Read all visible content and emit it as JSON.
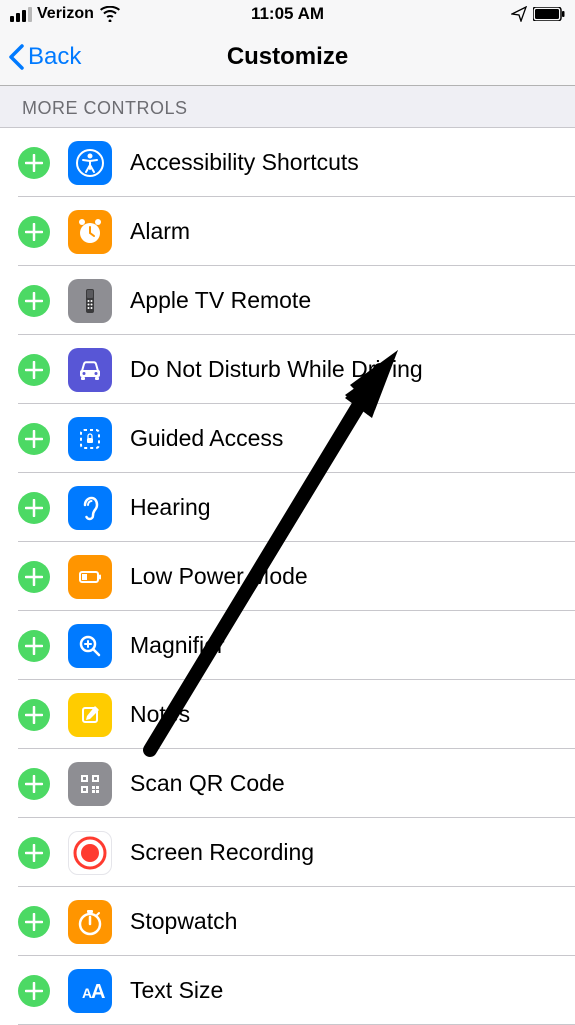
{
  "statusBar": {
    "carrier": "Verizon",
    "time": "11:05 AM"
  },
  "nav": {
    "back": "Back",
    "title": "Customize"
  },
  "section": {
    "header": "MORE CONTROLS"
  },
  "items": [
    {
      "label": "Accessibility Shortcuts",
      "iconClass": "icon-accessibility",
      "icon": "accessibility"
    },
    {
      "label": "Alarm",
      "iconClass": "icon-alarm",
      "icon": "alarm"
    },
    {
      "label": "Apple TV Remote",
      "iconClass": "icon-appletv",
      "icon": "appletv"
    },
    {
      "label": "Do Not Disturb While Driving",
      "iconClass": "icon-dnd",
      "icon": "car"
    },
    {
      "label": "Guided Access",
      "iconClass": "icon-guided",
      "icon": "lock-dashed"
    },
    {
      "label": "Hearing",
      "iconClass": "icon-hearing",
      "icon": "ear"
    },
    {
      "label": "Low Power Mode",
      "iconClass": "icon-lowpower",
      "icon": "battery"
    },
    {
      "label": "Magnifier",
      "iconClass": "icon-magnifier",
      "icon": "magnifier"
    },
    {
      "label": "Notes",
      "iconClass": "icon-notes",
      "icon": "notes"
    },
    {
      "label": "Scan QR Code",
      "iconClass": "icon-qr",
      "icon": "qr"
    },
    {
      "label": "Screen Recording",
      "iconClass": "icon-screenrec",
      "icon": "record"
    },
    {
      "label": "Stopwatch",
      "iconClass": "icon-stopwatch",
      "icon": "stopwatch"
    },
    {
      "label": "Text Size",
      "iconClass": "icon-textsize",
      "icon": "textsize"
    }
  ]
}
